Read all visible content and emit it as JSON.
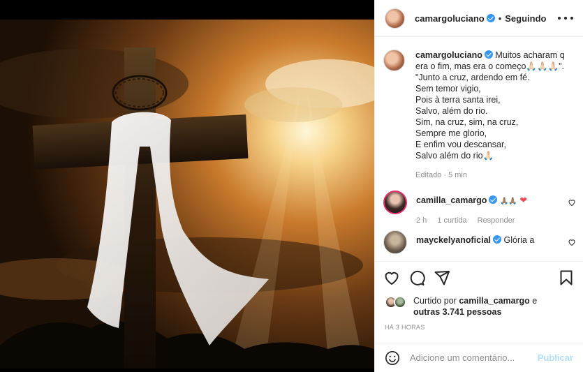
{
  "post": {
    "username": "camargoluciano",
    "follow_status": "Seguindo",
    "separator": "•"
  },
  "caption": {
    "username": "camargoluciano",
    "first_line": "Muitos acharam q era o fim, mas era o começo🙏🏻🙏🏻🙏🏻\".",
    "lines": [
      "\"Junto a cruz, ardendo em fé.",
      "Sem temor vigio,",
      "Pois à terra santa irei,",
      "Salvo, além do rio.",
      "Sim, na cruz, sim, na cruz,",
      "Sempre me glorio,",
      "E enfim vou descansar,",
      "Salvo além do rio🙏🏻"
    ],
    "meta": "Editado · 5 min"
  },
  "comments": [
    {
      "username": "camilla_camargo",
      "text": "🙏🏽🙏🏽",
      "heart": "❤",
      "time": "2 h",
      "likes": "1 curtida",
      "reply": "Responder"
    },
    {
      "username": "mayckelyanoficial",
      "text": "Glória a"
    }
  ],
  "liked_by": {
    "prefix": "Curtido por ",
    "user": "camilla_camargo",
    "middle": " e ",
    "rest": "outras 3.741 pessoas"
  },
  "timestamp": "Há 3 horas",
  "add_comment": {
    "placeholder": "Adicione um comentário...",
    "publish_label": "Publicar"
  },
  "colors": {
    "verified": "#3897f0",
    "publish_disabled": "#b2dffc",
    "story_ring": "#e1306c",
    "heart": "#ed4956"
  },
  "icons": [
    "heart-icon",
    "comment-icon",
    "share-icon",
    "bookmark-icon",
    "more-icon",
    "emoji-icon",
    "verified-icon"
  ]
}
